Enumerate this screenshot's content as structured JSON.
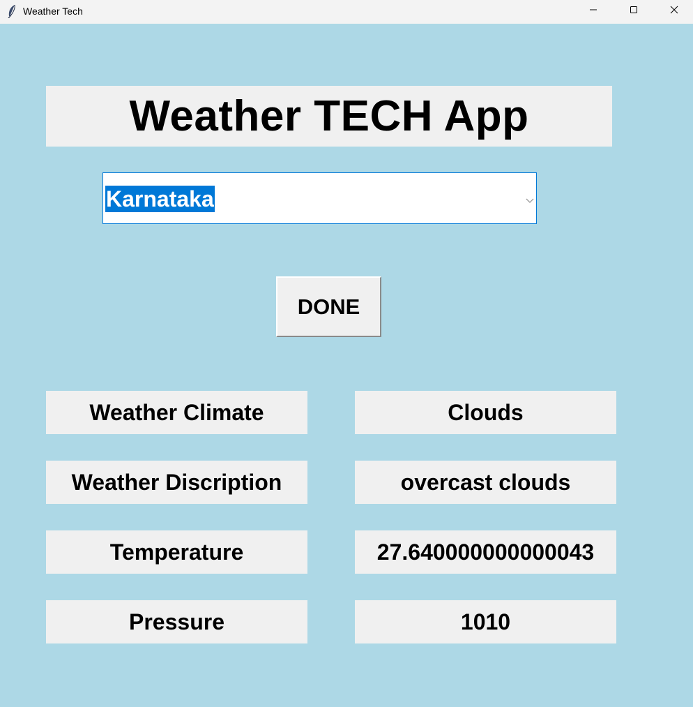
{
  "window": {
    "title": "Weather Tech",
    "icon": "feather-icon",
    "controls": [
      "minimize-icon",
      "maximize-icon",
      "close-icon"
    ]
  },
  "app": {
    "heading": "Weather TECH App",
    "state_select": {
      "value": "Karnataka",
      "selected_highlight_color": "#0078d7"
    },
    "done_label": "DONE",
    "background_color": "#add8e6",
    "panel_color": "#f0f0f0"
  },
  "results": {
    "climate": {
      "label": "Weather Climate",
      "value": "Clouds"
    },
    "description": {
      "label": "Weather Discription",
      "value": "overcast clouds"
    },
    "temperature": {
      "label": "Temperature",
      "value": "27.640000000000043"
    },
    "pressure": {
      "label": "Pressure",
      "value": "1010"
    }
  }
}
